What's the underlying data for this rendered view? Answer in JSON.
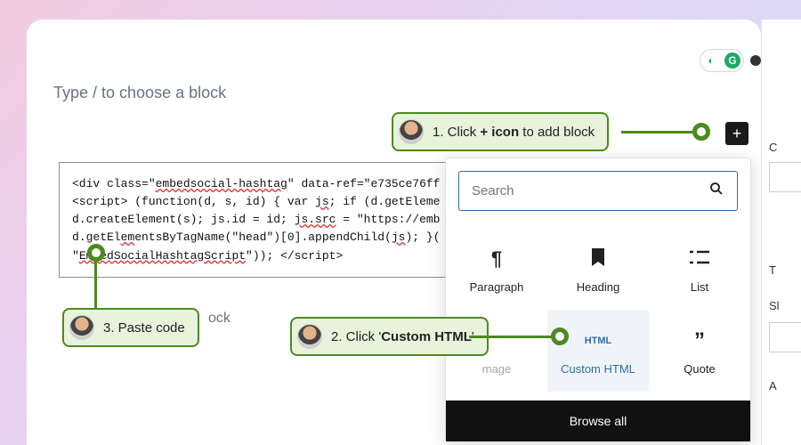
{
  "editor": {
    "placeholder": "Type / to choose a block",
    "under_placeholder": "ock",
    "code_line1_a": "<div class=\"",
    "code_line1_u1": "embedsocial-hashtag",
    "code_line1_b": "\" data-ref=\"e735ce76ff",
    "code_line2_a": "<script> (function(d, s, id) { var ",
    "code_line2_u1": "js",
    "code_line2_b": "; if (d.getEleme",
    "code_line3_a": "d.createElement(s); js.id = id; ",
    "code_line3_u1": "js.src",
    "code_line3_b": " = \"https://emb",
    "code_line4_a": "d.getEl",
    "code_line4_u1": "em",
    "code_line4_b": "entsByTagName(\"head\")[0].appendChild(",
    "code_line4_u2": "js",
    "code_line4_c": "); }(",
    "code_line5_a": "\"",
    "code_line5_u1": "EmbedSocialHashtagScript",
    "code_line5_b": "\")); </script>"
  },
  "panel": {
    "search_placeholder": "Search",
    "items": {
      "paragraph": "Paragraph",
      "heading": "Heading",
      "list": "List",
      "image": "mage",
      "custom_html_tag": "HTML",
      "custom_html": "Custom HTML",
      "quote": "Quote"
    },
    "browse": "Browse all"
  },
  "callouts": {
    "step1_a": "1. Click ",
    "step1_b": "+ icon",
    "step1_c": " to add block",
    "step2_a": "2. Click '",
    "step2_b": "Custom HTML",
    "step2_c": "'",
    "step3": "3. Paste code"
  },
  "sidebar": {
    "c": "C",
    "t": "T",
    "s": "Sl",
    "a": "A"
  }
}
